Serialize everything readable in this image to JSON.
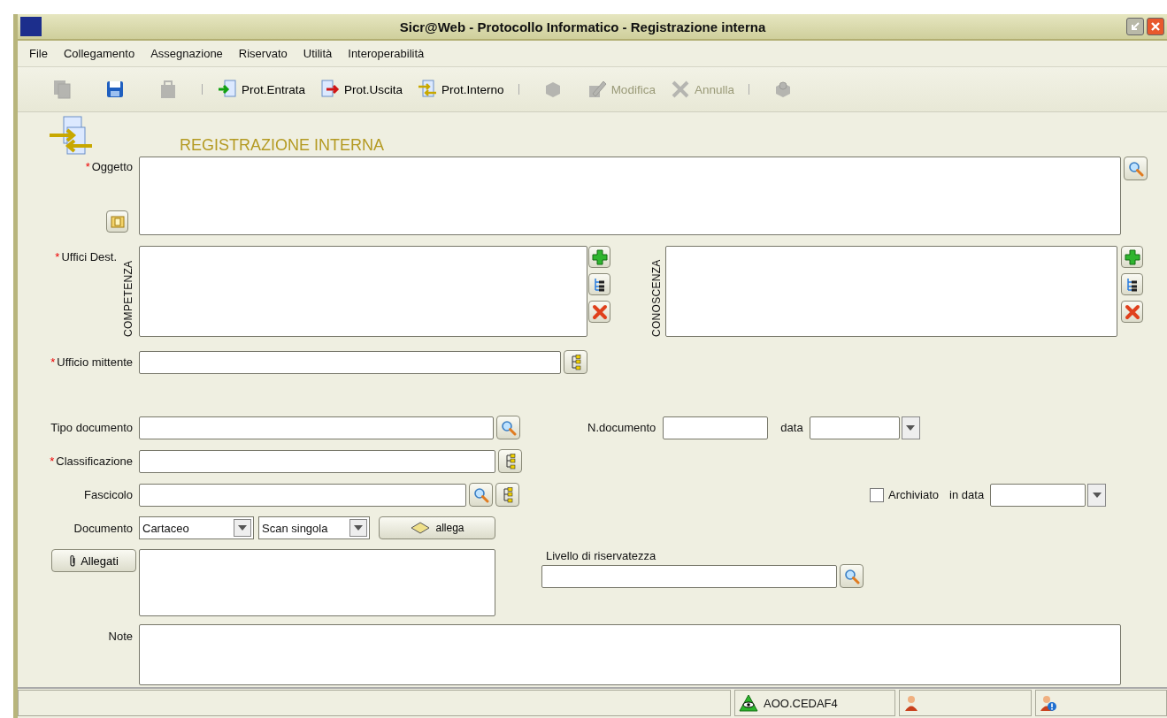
{
  "window": {
    "title": "Sicr@Web - Protocollo Informatico - Registrazione interna"
  },
  "menu": [
    "File",
    "Collegamento",
    "Assegnazione",
    "Riservato",
    "Utilità",
    "Interoperabilità"
  ],
  "toolbar": [
    {
      "kind": "button",
      "disabled": true
    },
    {
      "kind": "button",
      "disabled": false
    },
    {
      "kind": "button",
      "disabled": true
    },
    {
      "kind": "separator"
    },
    {
      "kind": "button",
      "label": "Prot.Entrata",
      "disabled": false
    },
    {
      "kind": "button",
      "label": "Prot.Uscita",
      "disabled": false
    },
    {
      "kind": "button",
      "label": "Prot.Interno",
      "disabled": false
    },
    {
      "kind": "separator"
    },
    {
      "kind": "button",
      "disabled": true
    },
    {
      "kind": "button",
      "label": "Modifica",
      "disabled": true
    },
    {
      "kind": "button",
      "label": "Annulla",
      "disabled": true
    },
    {
      "kind": "separator"
    },
    {
      "kind": "button",
      "disabled": true
    }
  ],
  "form": {
    "heading": "REGISTRAZIONE INTERNA",
    "oggetto": {
      "mark": "*",
      "label": "Oggetto"
    },
    "uffici_dest": {
      "mark": "*",
      "label": "Uffici Dest.",
      "competenza": "COMPETENZA",
      "conoscenza": "CONOSCENZA"
    },
    "ufficio_mittente": {
      "mark": "*",
      "label": "Ufficio mittente"
    },
    "tipo_documento": {
      "label": "Tipo documento"
    },
    "n_documento": {
      "label": "N.documento"
    },
    "data": {
      "label": "data"
    },
    "classificazione": {
      "mark": "*",
      "label": "Classificazione"
    },
    "fascicolo": {
      "label": "Fascicolo"
    },
    "archiviato": {
      "label": "Archiviato",
      "checked": false
    },
    "in_data": {
      "label": "in data"
    },
    "documento": {
      "label": "Documento",
      "tipo": "Cartaceo",
      "scan": "Scan singola",
      "allega": "allega"
    },
    "allegati": {
      "label": "Allegati"
    },
    "livello": {
      "label": "Livello di riservatezza"
    },
    "note": {
      "label": "Note"
    }
  },
  "status_bar": {
    "aoo": "AOO.CEDAF4"
  }
}
